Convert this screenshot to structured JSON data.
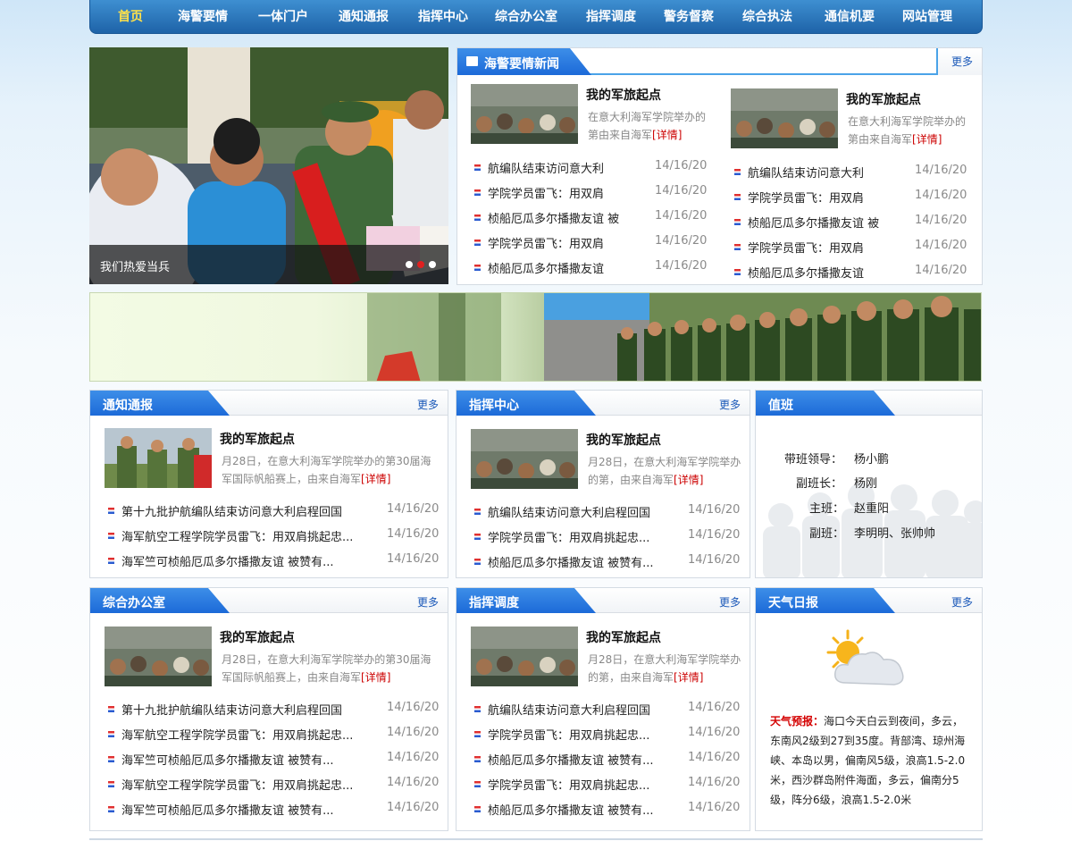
{
  "nav": {
    "items": [
      "首页",
      "海警要情",
      "一体门户",
      "通知通报",
      "指挥中心",
      "综合办公室",
      "指挥调度",
      "警务督察",
      "综合执法",
      "通信机要",
      "网站管理"
    ]
  },
  "slider": {
    "caption": "我们热爱当兵",
    "slide_count": 3,
    "active_slide": 2
  },
  "common": {
    "more": "更多",
    "detail": "[详情]"
  },
  "news": {
    "title": "海警要情新闻",
    "features": [
      {
        "title": "我的军旅起点",
        "desc": "在意大利海军学院举办的第由来自海军"
      },
      {
        "title": "我的军旅起点",
        "desc": "在意大利海军学院举办的第由来自海军"
      }
    ],
    "left_list": [
      {
        "title": "航编队结束访问意大利",
        "date": "14/16/20"
      },
      {
        "title": "学院学员雷飞：用双肩",
        "date": "14/16/20"
      },
      {
        "title": "桢船厄瓜多尔播撒友谊 被",
        "date": "14/16/20"
      },
      {
        "title": "学院学员雷飞：用双肩",
        "date": "14/16/20"
      },
      {
        "title": "桢船厄瓜多尔播撒友谊",
        "date": "14/16/20"
      }
    ],
    "right_list": [
      {
        "title": "航编队结束访问意大利",
        "date": "14/16/20"
      },
      {
        "title": "学院学员雷飞：用双肩",
        "date": "14/16/20"
      },
      {
        "title": "桢船厄瓜多尔播撒友谊 被",
        "date": "14/16/20"
      },
      {
        "title": "学院学员雷飞：用双肩",
        "date": "14/16/20"
      },
      {
        "title": "桢船厄瓜多尔播撒友谊",
        "date": "14/16/20"
      }
    ]
  },
  "notice": {
    "title": "通知通报",
    "feature": {
      "title": "我的军旅起点",
      "desc": "月28日，在意大利海军学院举办的第30届海军国际帆船赛上，由来自海军"
    },
    "list": [
      {
        "title": "第十九批护航编队结束访问意大利启程回国",
        "date": "14/16/20"
      },
      {
        "title": "海军航空工程学院学员雷飞：用双肩挑起忠...",
        "date": "14/16/20"
      },
      {
        "title": "海军竺可桢船厄瓜多尔播撒友谊 被赞有...",
        "date": "14/16/20"
      }
    ]
  },
  "command": {
    "title": "指挥中心",
    "feature": {
      "title": "我的军旅起点",
      "desc": "月28日，在意大利海军学院举办的第，由来自海军"
    },
    "list": [
      {
        "title": "航编队结束访问意大利启程回国",
        "date": "14/16/20"
      },
      {
        "title": "学院学员雷飞：用双肩挑起忠...",
        "date": "14/16/20"
      },
      {
        "title": "桢船厄瓜多尔播撒友谊 被赞有...",
        "date": "14/16/20"
      }
    ]
  },
  "duty": {
    "title": "值班",
    "rows": [
      {
        "label": "带班领导：",
        "value": "杨小鹏"
      },
      {
        "label": "副班长：",
        "value": "杨刚"
      },
      {
        "label": "主班：",
        "value": "赵重阳"
      },
      {
        "label": "副班：",
        "value": "李明明、张帅帅"
      }
    ]
  },
  "office": {
    "title": "综合办公室",
    "feature": {
      "title": "我的军旅起点",
      "desc": "月28日，在意大利海军学院举办的第30届海军国际帆船赛上，由来自海军"
    },
    "list": [
      {
        "title": "第十九批护航编队结束访问意大利启程回国",
        "date": "14/16/20"
      },
      {
        "title": "海军航空工程学院学员雷飞：用双肩挑起忠...",
        "date": "14/16/20"
      },
      {
        "title": "海军竺可桢船厄瓜多尔播撒友谊 被赞有...",
        "date": "14/16/20"
      },
      {
        "title": "海军航空工程学院学员雷飞：用双肩挑起忠...",
        "date": "14/16/20"
      },
      {
        "title": "海军竺可桢船厄瓜多尔播撒友谊 被赞有...",
        "date": "14/16/20"
      }
    ]
  },
  "dispatch": {
    "title": "指挥调度",
    "feature": {
      "title": "我的军旅起点",
      "desc": "月28日，在意大利海军学院举办的第，由来自海军"
    },
    "list": [
      {
        "title": "航编队结束访问意大利启程回国",
        "date": "14/16/20"
      },
      {
        "title": "学院学员雷飞：用双肩挑起忠...",
        "date": "14/16/20"
      },
      {
        "title": "桢船厄瓜多尔播撒友谊 被赞有...",
        "date": "14/16/20"
      },
      {
        "title": "学院学员雷飞：用双肩挑起忠...",
        "date": "14/16/20"
      },
      {
        "title": "桢船厄瓜多尔播撒友谊 被赞有...",
        "date": "14/16/20"
      }
    ]
  },
  "weather": {
    "title": "天气日报",
    "label": "天气预报：",
    "text": "海口今天白云到夜间，多云，东南风2级到27到35度。背部湾、琼州海峡、本岛以男，偏南风5级，浪高1.5-2.0米，西沙群岛附件海面，多云，偏南分5级，阵分6级，浪高1.5-2.0米"
  },
  "colors": {
    "nav_blue": "#1e63a8",
    "tab_blue": "#1c6ad8",
    "active_nav": "#ffe14a",
    "detail_red": "#cc0000"
  }
}
